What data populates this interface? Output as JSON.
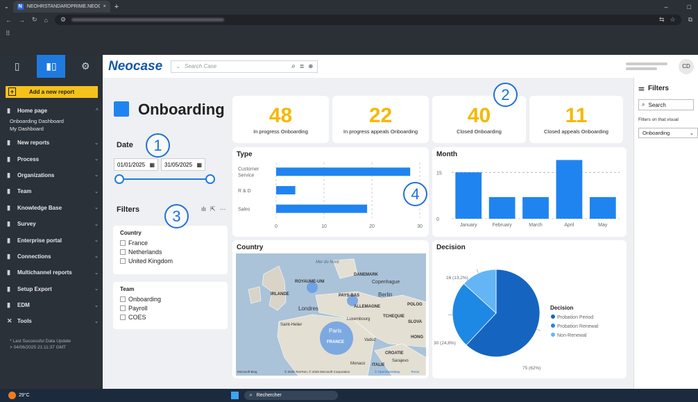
{
  "browser": {
    "tab_title": "NEOHRSTANDARDPRIME.NEOC",
    "tab_favicon": "N",
    "new_tab": "+",
    "minimize": "–",
    "maximize": "□"
  },
  "appbar": {
    "logo": "Neocase",
    "search_placeholder": "Search Case",
    "search_mode": "⌄",
    "avatar": "CD"
  },
  "sidebar": {
    "add_report": "Add a new report",
    "items": [
      {
        "label": "Home page",
        "subs": [
          "Onboarding Dashboard",
          "My Dashboard"
        ]
      },
      {
        "label": "New reports"
      },
      {
        "label": "Process"
      },
      {
        "label": "Organizations"
      },
      {
        "label": "Team"
      },
      {
        "label": "Knowledge Base"
      },
      {
        "label": "Survey"
      },
      {
        "label": "Enterprise portal"
      },
      {
        "label": "Connections"
      },
      {
        "label": "Multichannel reports"
      },
      {
        "label": "Setup Export"
      },
      {
        "label": "EDM"
      },
      {
        "label": "Tools"
      }
    ],
    "last_update_1": "* Last Successful Data Update",
    "last_update_2": "> 04/06/2025 21:11:37 GMT"
  },
  "dashboard": {
    "title": "Onboarding",
    "date_label": "Date",
    "date_from": "01/01/2025",
    "date_to": "31/05/2025",
    "filters_label": "Filters",
    "country_title": "Country",
    "countries": [
      "France",
      "Netherlands",
      "United Kingdom"
    ],
    "team_title": "Team",
    "teams": [
      "Onboarding",
      "Payroll",
      "COES"
    ],
    "kpis": [
      {
        "value": "48",
        "label": "In progress Onboarding"
      },
      {
        "value": "22",
        "label": "In progress appeals Onboarding"
      },
      {
        "value": "40",
        "label": "Closed Onboarding"
      },
      {
        "value": "11",
        "label": "Closed appeals Onboarding"
      }
    ],
    "annotations": [
      "1",
      "2",
      "3",
      "4"
    ],
    "country_panel_title": "Country",
    "map_labels": {
      "uk": "ROYAUME-UNI",
      "irl": "IRLANDE",
      "nl": "PAYS-BAS",
      "de": "ALLEMAGNE",
      "fr": "FRANCE",
      "dk": "DANEMARK",
      "lux": "Luxembourg",
      "cz": "TCHEQUIE",
      "it": "ITALIE",
      "ldn": "Londres",
      "ber": "Berlin",
      "cop": "Copenhague",
      "par": "Paris",
      "sea": "Mer du Nord",
      "pol": "POLOG",
      "slo": "SLOVA",
      "hong": "HONG",
      "croa": "CROATIE",
      "sar": "Sarajevo",
      "mon": "Monaco",
      "vad": "Vaduz",
      "sth": "Saint-Helier",
      "bing": "Microsoft Bing",
      "copy": "© 2025 TomTom, © 2025 Microsoft Corporation",
      "osm": "© OpenStreetMap",
      "terms": "Terms"
    },
    "right_filters": {
      "title": "Filters",
      "search": "Search",
      "on_visual": "Filters on that visual",
      "selected": "Onboarding"
    }
  },
  "taskbar": {
    "weather": "29°C",
    "search": "Rechercher"
  },
  "chart_data": [
    {
      "type": "bar",
      "title": "Type",
      "orientation": "horizontal",
      "categories": [
        "Customer Service",
        "R & D",
        "Sales"
      ],
      "values": [
        28,
        4,
        19
      ],
      "xticks": [
        0,
        10,
        20,
        30
      ],
      "xlim": [
        0,
        30
      ]
    },
    {
      "type": "bar",
      "title": "Month",
      "categories": [
        "January",
        "February",
        "March",
        "April",
        "May"
      ],
      "values": [
        15,
        7,
        7,
        19,
        7
      ],
      "yticks": [
        0,
        15
      ],
      "ylim": [
        0,
        20
      ],
      "reference_line": 15
    },
    {
      "type": "pie",
      "title": "Decision",
      "legend_title": "Decision",
      "slices": [
        {
          "label": "Probation Period",
          "value": 75,
          "text": "75 (62%)",
          "color": "#1565c0"
        },
        {
          "label": "Probation Renewal",
          "value": 30,
          "text": "30 (24,8%)",
          "color": "#1e88e5"
        },
        {
          "label": "Non-Renewal",
          "value": 16,
          "text": "16 (13,2%)",
          "color": "#64b5f6"
        }
      ]
    }
  ]
}
